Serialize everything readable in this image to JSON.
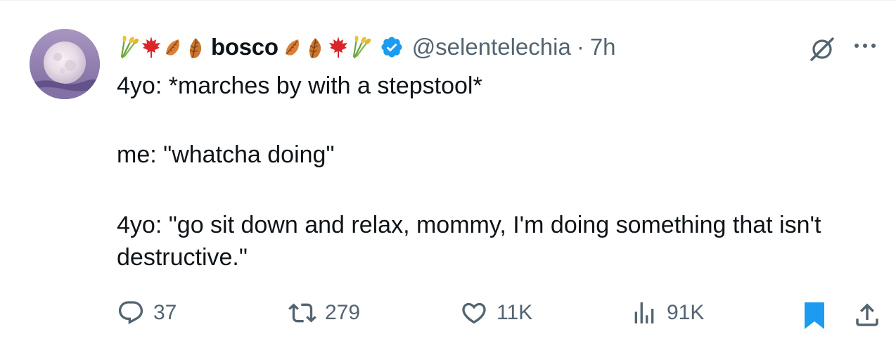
{
  "tweet": {
    "display_name": "bosco",
    "name_emojis_left": [
      "sheaf-of-rice-icon",
      "maple-leaf-icon",
      "fallen-leaf-icon",
      "fallen-leaf-icon"
    ],
    "name_emojis_right": [
      "fallen-leaf-icon",
      "fallen-leaf-icon",
      "maple-leaf-icon",
      "sheaf-of-rice-icon"
    ],
    "verified": true,
    "handle": "@selentelechia",
    "separator": "·",
    "time": "7h",
    "paragraphs": [
      "4yo: *marches by with a stepstool*",
      "me: \"whatcha doing\"",
      "4yo: \"go sit down and relax, mommy, I'm doing something that isn't destructive.\""
    ]
  },
  "actions": {
    "replies": "37",
    "retweets": "279",
    "likes": "11K",
    "views": "91K"
  },
  "colors": {
    "text_primary": "#0f1419",
    "text_secondary": "#536471",
    "verified_blue": "#1d9bf0",
    "bookmark_blue": "#1d9bf0"
  }
}
